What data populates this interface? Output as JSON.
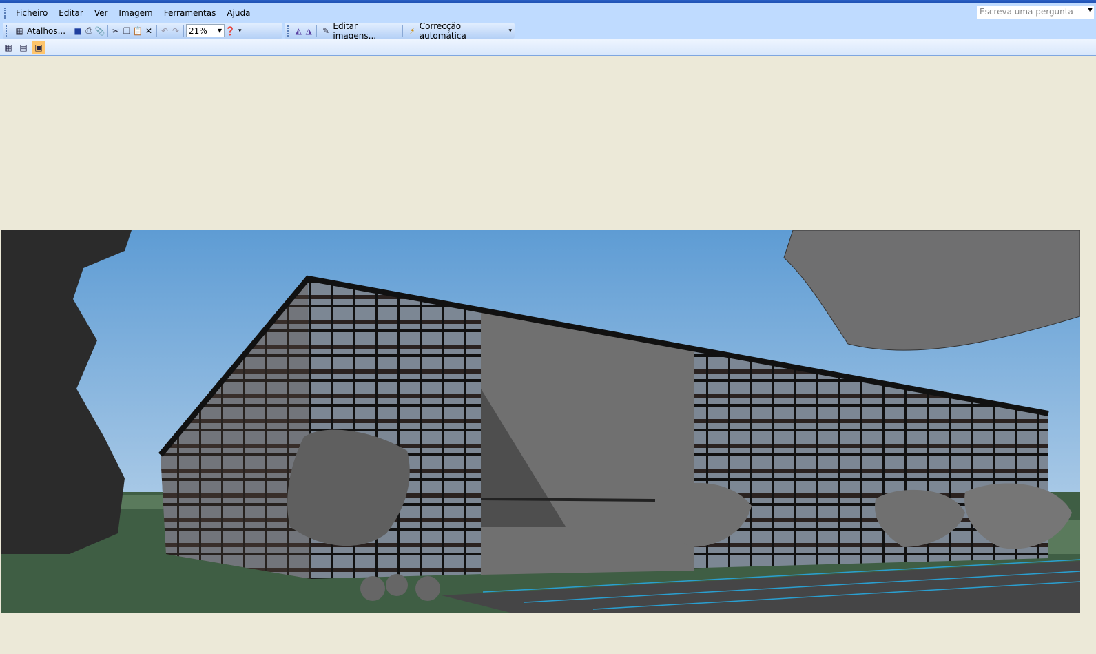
{
  "menu": {
    "items": [
      "Ficheiro",
      "Editar",
      "Ver",
      "Imagem",
      "Ferramentas",
      "Ajuda"
    ]
  },
  "ask": {
    "placeholder": "Escreva uma pergunta"
  },
  "toolbar": {
    "shortcuts": "Atalhos...",
    "zoom": "21%",
    "edit_images": "Editar imagens...",
    "auto_correct": "Correcção automática"
  },
  "view": {
    "active": "single-image-view"
  },
  "colors": {
    "toolbar": "#bfdbff",
    "canvas": "#ece9d8",
    "sky": "#5f9fd6",
    "grass": "#3f5e44"
  }
}
